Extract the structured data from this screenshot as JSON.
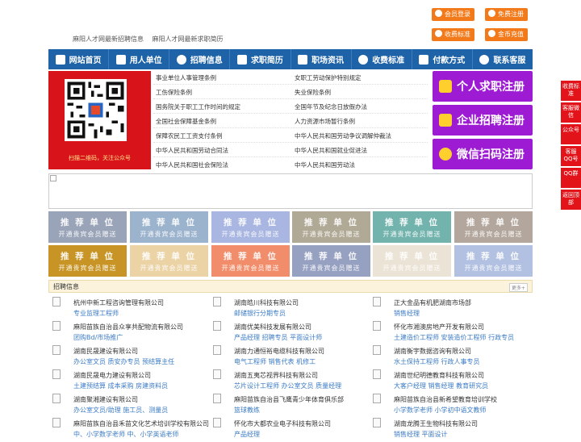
{
  "top": {
    "links": [
      "麻阳人才网最新招聘信息",
      "麻阳人才网最新求职简历"
    ],
    "buttons": [
      {
        "label": "会员登录",
        "icon": "user-icon"
      },
      {
        "label": "免费注册",
        "icon": "register-icon"
      },
      {
        "label": "收费标准",
        "icon": "yen-icon"
      },
      {
        "label": "金币充值",
        "icon": "coin-icon"
      }
    ]
  },
  "nav": [
    {
      "label": "网站首页",
      "icon": "home-icon"
    },
    {
      "label": "用人单位",
      "icon": "building-icon"
    },
    {
      "label": "招聘信息",
      "icon": "megaphone-icon"
    },
    {
      "label": "求职简历",
      "icon": "resume-icon"
    },
    {
      "label": "职场资讯",
      "icon": "news-icon"
    },
    {
      "label": "收费标准",
      "icon": "yen-icon"
    },
    {
      "label": "付款方式",
      "icon": "card-icon"
    },
    {
      "label": "联系客服",
      "icon": "phone-icon"
    }
  ],
  "qr": {
    "caption": "扫描二维码，关注公众号"
  },
  "laws": {
    "left": [
      "事业单位人事管理条例",
      "工伤保险条例",
      "国务院关于职工工作时间的规定",
      "全国社会保障基金条例",
      "保障农民工工资支付条例",
      "中华人民共和国劳动合同法",
      "中华人民共和国社会保险法"
    ],
    "right": [
      "女职工劳动保护特别规定",
      "失业保险条例",
      "全国年节及纪念日放假办法",
      "人力资源市场暂行条例",
      "中华人民共和国劳动争议调解仲裁法",
      "中华人民共和国就业促进法",
      "中华人民共和国劳动法"
    ]
  },
  "register": [
    {
      "label": "个人求职注册",
      "icon": "person-icon"
    },
    {
      "label": "企业招聘注册",
      "icon": "company-icon"
    },
    {
      "label": "微信扫码注册",
      "icon": "wechat-icon"
    }
  ],
  "recommend": {
    "title": "推 荐 单 位",
    "sub": "开通贵宾会员赠送",
    "colors": [
      "#9aa4b8",
      "#9cb3cd",
      "#a8b6e1",
      "#b0a995",
      "#73b3ad",
      "#b3a79d",
      "#c79425",
      "#ecd3a6",
      "#f28d6b",
      "#96a0c1",
      "#ebe4d6",
      "#b2c1e1"
    ]
  },
  "jobs": {
    "title": "招聘信息",
    "more": "更多+",
    "items": [
      {
        "company": "杭州中新工程咨询管理有限公司",
        "positions": "专业监理工程师"
      },
      {
        "company": "湖南皓川科技有限公司",
        "positions": "邮储银行分期专员"
      },
      {
        "company": "正大金品有机肥湖南市场部",
        "positions": "销售经理"
      },
      {
        "company": "麻阳苗族自治县众享共配物流有限公司",
        "positions": "团购Bd/市场推广"
      },
      {
        "company": "湖南优美科技发展有限公司",
        "positions": "产品经理 招聘专员 平面设计师"
      },
      {
        "company": "怀化市湘澳房地产开发有限公司",
        "positions": "土建造价工程师 安装造价工程师 行政专员"
      },
      {
        "company": "湖南民晟建设有限公司",
        "positions": "办公室文员 质安办专员 预结算主任"
      },
      {
        "company": "湖南力通恒裕电缆科技有限公司",
        "positions": "电气工程师 销售代表 机修工"
      },
      {
        "company": "湖南衡宇数据咨询有限公司",
        "positions": "水土保持工程师 行政人事专员"
      },
      {
        "company": "湖南民晟电力建设有限公司",
        "positions": "土建预结算 成本采购 房建资料员"
      },
      {
        "company": "湖南五夷芯视界科技有限公司",
        "positions": "芯片设计工程师 办公室文员 质量经理"
      },
      {
        "company": "湖南世纪明德教育科技有限公司",
        "positions": "大客户经理 销售经理 教育研究员"
      },
      {
        "company": "湖南聚湘建设有限公司",
        "positions": "办公室文员/助理 施工员、测量员"
      },
      {
        "company": "麻阳苗族自治县飞鹰青少年体育俱乐部",
        "positions": "篮球教练"
      },
      {
        "company": "麻阳苗族自治县新希望教育培训学校",
        "positions": "小学数学老师 小学初中语文教师"
      },
      {
        "company": "麻阳苗族自治县禾苗文化艺术培训学校有限公司",
        "positions": "中、小学数学老师 中、小学英语老师"
      },
      {
        "company": "怀化市大都农业电子科技有限公司",
        "positions": "产品经理"
      },
      {
        "company": "湖南龙腾王生物科技有限公司",
        "positions": "销售经理 平面设计"
      }
    ]
  },
  "sidebar": [
    {
      "label": "收费标准"
    },
    {
      "label": "客服微信"
    },
    {
      "label": "公众号"
    },
    {
      "label": "客服QQ号"
    },
    {
      "label": "QQ群"
    },
    {
      "label": "返回顶部"
    }
  ]
}
